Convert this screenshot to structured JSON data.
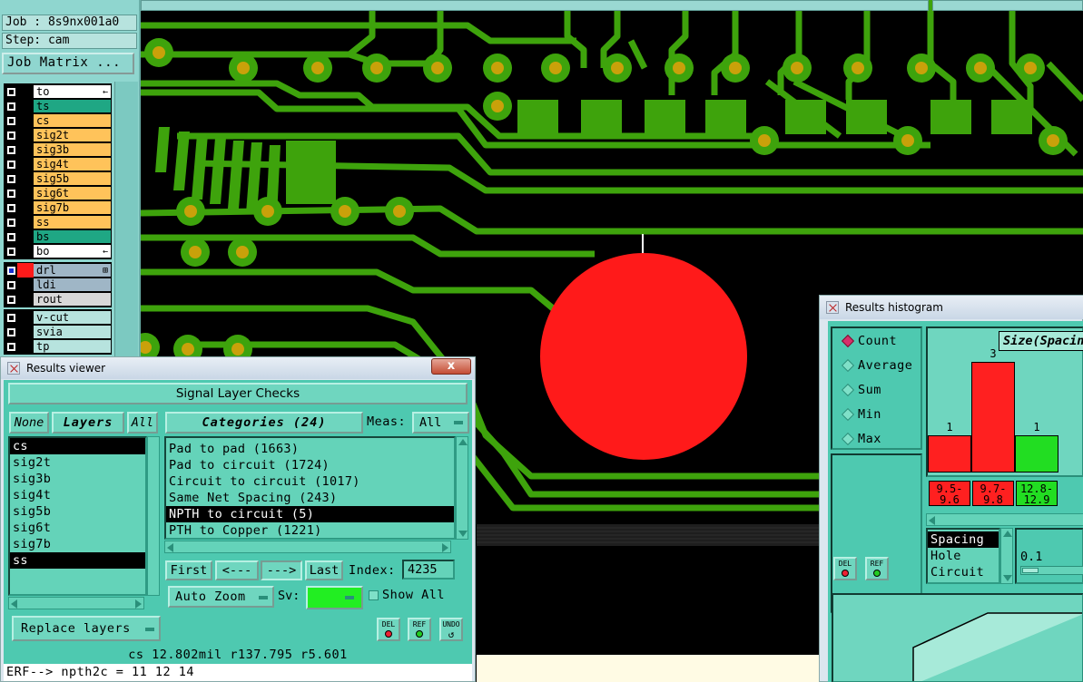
{
  "job": {
    "job_label": "Job : 8s9nx001a0",
    "step_label": "Step: cam",
    "matrix_button": "Job Matrix ..."
  },
  "layers_panel": {
    "groups": [
      [
        {
          "name": "to",
          "color": "#ffffff",
          "arrow": "←"
        },
        {
          "name": "ts",
          "color": "#1fa784",
          "arrow": ""
        },
        {
          "name": "cs",
          "color": "#ffc35a",
          "arrow": ""
        },
        {
          "name": "sig2t",
          "color": "#ffc35a",
          "arrow": ""
        },
        {
          "name": "sig3b",
          "color": "#ffc35a",
          "arrow": ""
        },
        {
          "name": "sig4t",
          "color": "#ffc35a",
          "arrow": ""
        },
        {
          "name": "sig5b",
          "color": "#ffc35a",
          "arrow": ""
        },
        {
          "name": "sig6t",
          "color": "#ffc35a",
          "arrow": ""
        },
        {
          "name": "sig7b",
          "color": "#ffc35a",
          "arrow": ""
        },
        {
          "name": "ss",
          "color": "#ffc35a",
          "arrow": ""
        },
        {
          "name": "bs",
          "color": "#1fa784",
          "arrow": ""
        },
        {
          "name": "bo",
          "color": "#ffffff",
          "arrow": "←"
        }
      ],
      [
        {
          "name": "drl",
          "color": "#9fb6c6",
          "arrow": "⊞"
        },
        {
          "name": "ldi",
          "color": "#9fb6c6",
          "arrow": ""
        },
        {
          "name": "rout",
          "color": "#d8d8d8",
          "arrow": ""
        }
      ],
      [
        {
          "name": "v-cut",
          "color": "#b7e3de",
          "arrow": ""
        },
        {
          "name": "svia",
          "color": "#b7e3de",
          "arrow": ""
        },
        {
          "name": "tp",
          "color": "#b7e3de",
          "arrow": ""
        }
      ]
    ]
  },
  "results_viewer": {
    "title": "Results viewer",
    "close_glyph": "x",
    "header": "Signal Layer Checks",
    "none_button": "None",
    "layers_button": "Layers",
    "all_button": "All",
    "layers": [
      "cs",
      "sig2t",
      "sig3b",
      "sig4t",
      "sig5b",
      "sig6t",
      "sig7b",
      "ss"
    ],
    "selected_layers": [
      0,
      7
    ],
    "categories_button": "Categories (24)",
    "meas_label": "Meas:",
    "meas_value": "All",
    "categories": [
      "Pad to pad (1663)",
      "Pad to circuit (1724)",
      "Circuit to circuit (1017)",
      "Same Net Spacing (243)",
      "NPTH to circuit (5)",
      "PTH to Copper (1221)"
    ],
    "selected_category": 4,
    "first_button": "First",
    "prev_button": "<---",
    "next_button": "--->",
    "last_button": "Last",
    "index_label": "Index:",
    "index_value": "4235",
    "auto_zoom_button": "Auto Zoom",
    "sv_label": "Sv:",
    "sv_color": "#22ee22",
    "show_all_label": "Show All",
    "replace_layers_button": "Replace layers",
    "del_label": "DEL",
    "ref_label": "REF",
    "undo_label": "UNDO",
    "status": "cs 12.802mil  r137.795  r5.601",
    "command": "ERF--> npth2c = 11 12 14"
  },
  "results_histogram": {
    "title": "Results histogram",
    "modes": [
      "Count",
      "Average",
      "Sum",
      "Min",
      "Max"
    ],
    "active_mode": "Count",
    "size_label": "Size(Spacin",
    "bins": [
      {
        "label_top": "9.5-",
        "label_bottom": "9.6",
        "count": 1,
        "color": "#ff2020"
      },
      {
        "label_top": "9.7-",
        "label_bottom": "9.8",
        "count": 3,
        "color": "#ff2020"
      },
      {
        "label_top": "12.8-",
        "label_bottom": "12.9",
        "count": 1,
        "color": "#22dd22"
      }
    ],
    "types": [
      "Spacing",
      "Hole",
      "Circuit"
    ],
    "selected_type": "Spacing",
    "value_field": "0.1",
    "del_label": "DEL",
    "ref_label": "REF"
  },
  "colors": {
    "copper": "#3ea30c",
    "pad_center": "#c9a10a",
    "marker": "#ff1a1a",
    "panel_teal": "#4ec9b0"
  }
}
